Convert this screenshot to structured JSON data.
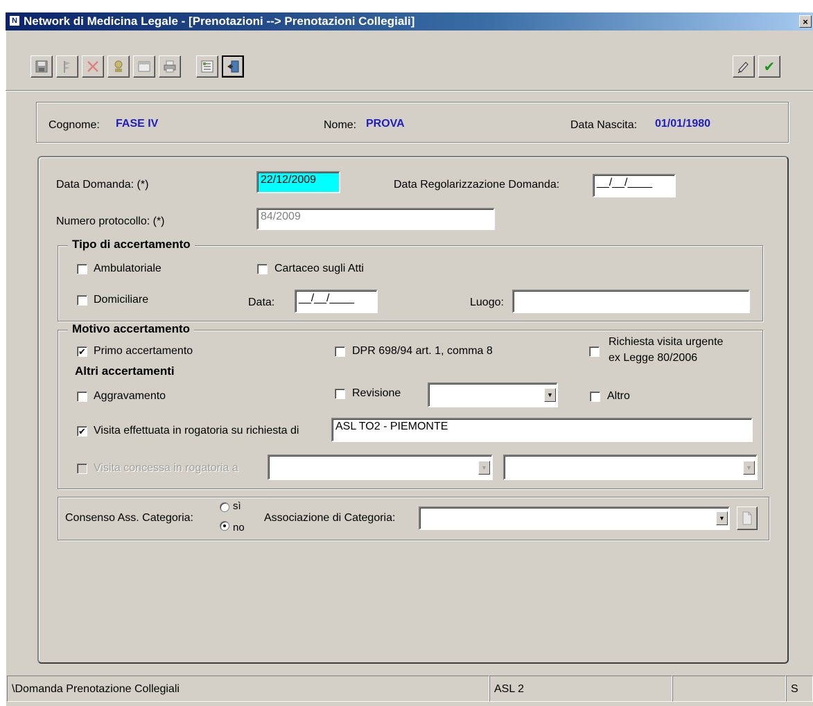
{
  "window": {
    "title": "Network di Medicina Legale - [Prenotazioni --> Prenotazioni Collegiali]",
    "close_glyph": "×"
  },
  "toolbar": {
    "left_icons": [
      "save-icon",
      "flag-icon",
      "delete-icon",
      "user-key-icon",
      "calendar-icon",
      "print-icon"
    ],
    "right_icons": [
      "list-icon",
      "exit-icon"
    ],
    "far_right_icons": [
      "pen-sign-icon",
      "confirm-check-icon"
    ]
  },
  "patient": {
    "surname_label": "Cognome:",
    "surname": "FASE IV",
    "name_label": "Nome:",
    "name": "PROVA",
    "birth_label": "Data Nascita:",
    "birth": "01/01/1980"
  },
  "form": {
    "data_domanda_label": "Data Domanda: (*)",
    "data_domanda": "22/12/2009",
    "data_reg_label": "Data Regolarizzazione Domanda:",
    "data_reg": "__/__/____",
    "protocollo_label": "Numero protocollo: (*)",
    "protocollo": "84/2009"
  },
  "tipo": {
    "legend": "Tipo di accertamento",
    "ambulatoriale": "Ambulatoriale",
    "cartaceo": "Cartaceo sugli Atti",
    "domiciliare": "Domiciliare",
    "data_label": "Data:",
    "data_value": "__/__/____",
    "luogo_label": "Luogo:",
    "luogo_value": ""
  },
  "motivo": {
    "legend": "Motivo accertamento",
    "primo": "Primo accertamento",
    "primo_checked": true,
    "dpr": "DPR 698/94 art. 1, comma 8",
    "urgente_line1": "Richiesta visita urgente",
    "urgente_line2": "ex Legge 80/2006",
    "altri_heading": "Altri accertamenti",
    "aggravamento": "Aggravamento",
    "revisione": "Revisione",
    "revisione_value": "",
    "altro": "Altro",
    "rogatoria_label": "Visita effettuata in rogatoria su richiesta di",
    "rogatoria_checked": true,
    "rogatoria_value": "ASL TO2 - PIEMONTE",
    "concessa_label": "Visita concessa in rogatoria a",
    "concessa_value1": "",
    "concessa_value2": ""
  },
  "consenso": {
    "label": "Consenso Ass. Categoria:",
    "yes": "sì",
    "no": "no",
    "selected": "no",
    "assoc_label": "Associazione di Categoria:",
    "assoc_value": ""
  },
  "statusbar": {
    "path": "\\Domanda Prenotazione Collegiali",
    "asl": "ASL 2",
    "empty": "",
    "mode": "S"
  },
  "glyphs": {
    "check": "✔",
    "dropdown": "▼",
    "dot": "●"
  }
}
